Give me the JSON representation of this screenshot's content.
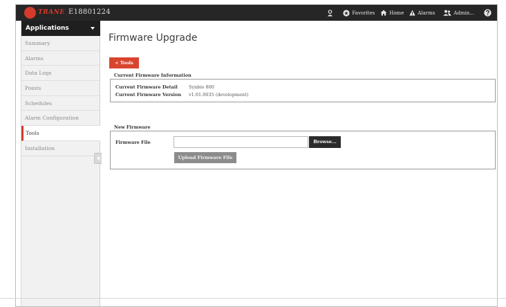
{
  "topbar": {
    "brand": "TRANE",
    "device_id": "E18801224",
    "nav": {
      "favorites": "Favorites",
      "home": "Home",
      "alarms": "Alarms",
      "admin": "Admin..."
    }
  },
  "sidebar": {
    "header": "Applications",
    "items": [
      {
        "label": "Summary"
      },
      {
        "label": "Alarms"
      },
      {
        "label": "Data Logs"
      },
      {
        "label": "Points"
      },
      {
        "label": "Schedules"
      },
      {
        "label": "Alarm Configuration"
      },
      {
        "label": "Tools"
      },
      {
        "label": "Installation"
      }
    ],
    "active_item": "Tools"
  },
  "main": {
    "title": "Firmware Upgrade",
    "back_button": "< Tools",
    "current_section_title": "Current Firmware Information",
    "current": {
      "detail_label": "Current Firmware Detail",
      "detail_value": "Synbio 800",
      "version_label": "Current Firmware Version",
      "version_value": "v1.01.0035 (development)"
    },
    "new_section_title": "New Firmware",
    "new": {
      "file_label": "Firmware File",
      "file_value": "",
      "browse_label": "Browse...",
      "upload_label": "Upload Firmware File"
    }
  },
  "colors": {
    "accent": "#d9442f",
    "topbar": "#262626",
    "sidebar_header": "#1f1f1f"
  }
}
